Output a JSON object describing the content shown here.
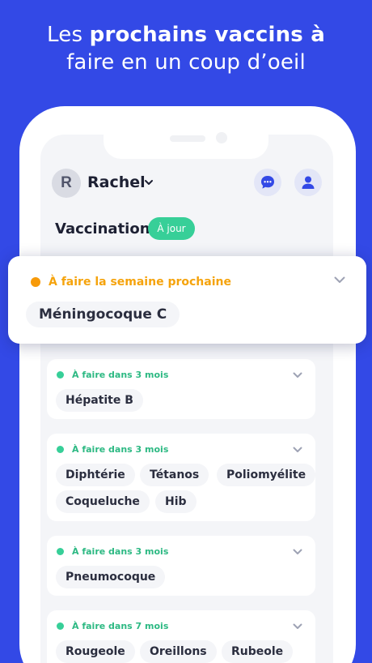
{
  "headline": {
    "line1_light": "Les ",
    "line1_bold": "prochains vaccins à",
    "line2": "faire en un coup d’oeil"
  },
  "header": {
    "avatar_initial": "R",
    "user_name": "Rachel"
  },
  "section": {
    "title": "Vaccination",
    "status": "À jour"
  },
  "highlight": {
    "when": "À faire la semaine prochaine",
    "vaccines": [
      "Méningocoque C"
    ]
  },
  "cards": [
    {
      "when": "À faire dans 3 mois",
      "vaccines": [
        "Hépatite B"
      ]
    },
    {
      "when": "À faire dans 3 mois",
      "vaccines": [
        "Diphtérie",
        "Tétanos",
        "Poliomyélite",
        "Coqueluche",
        "Hib"
      ]
    },
    {
      "when": "À faire dans 3 mois",
      "vaccines": [
        "Pneumocoque"
      ]
    },
    {
      "when": "À faire dans 7 mois",
      "vaccines": [
        "Rougeole",
        "Oreillons",
        "Rubeole"
      ]
    }
  ],
  "colors": {
    "background": "#3349e6",
    "accent_green": "#37cf98",
    "accent_orange": "#f79a09"
  }
}
